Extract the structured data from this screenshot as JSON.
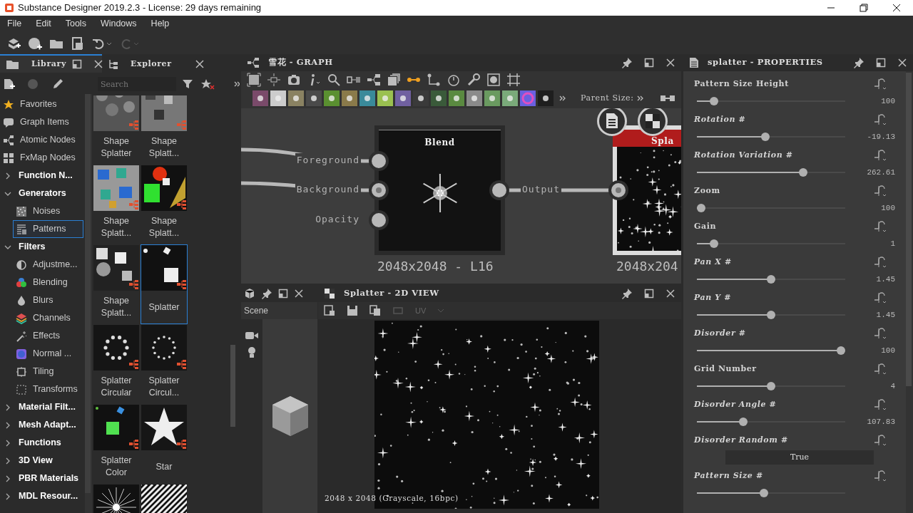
{
  "window": {
    "title": "Substance Designer 2019.2.3 - License: 29 days remaining"
  },
  "menu": [
    "File",
    "Edit",
    "Tools",
    "Windows",
    "Help"
  ],
  "library": {
    "tabs": [
      {
        "label": "Library",
        "selected": true
      },
      {
        "label": "Explorer",
        "selected": false
      }
    ],
    "search": {
      "placeholder": "Search"
    },
    "tree": [
      {
        "label": "Favorites",
        "kind": "item",
        "selected": false
      },
      {
        "label": "Graph Items",
        "kind": "item",
        "selected": false
      },
      {
        "label": "Atomic Nodes",
        "kind": "item",
        "selected": false
      },
      {
        "label": "FxMap Nodes",
        "kind": "item",
        "selected": false
      },
      {
        "label": "Function N...",
        "kind": "group",
        "expanded": false,
        "selected": false
      },
      {
        "label": "Generators",
        "kind": "group",
        "expanded": true,
        "selected": false,
        "children": [
          {
            "label": "Noises",
            "selected": false
          },
          {
            "label": "Patterns",
            "selected": true
          }
        ]
      },
      {
        "label": "Filters",
        "kind": "group",
        "expanded": true,
        "selected": false,
        "children": [
          {
            "label": "Adjustme...",
            "selected": false
          },
          {
            "label": "Blending",
            "selected": false
          },
          {
            "label": "Blurs",
            "selected": false
          },
          {
            "label": "Channels",
            "selected": false
          },
          {
            "label": "Effects",
            "selected": false
          },
          {
            "label": "Normal ...",
            "selected": false
          },
          {
            "label": "Tiling",
            "selected": false
          },
          {
            "label": "Transforms",
            "selected": false
          }
        ]
      },
      {
        "label": "Material Filt...",
        "kind": "group",
        "expanded": false,
        "selected": false
      },
      {
        "label": "Mesh Adapt...",
        "kind": "group",
        "expanded": false,
        "selected": false
      },
      {
        "label": "Functions",
        "kind": "group",
        "expanded": false,
        "selected": false
      },
      {
        "label": "3D View",
        "kind": "group",
        "expanded": false,
        "selected": false
      },
      {
        "label": "PBR Materials",
        "kind": "group",
        "expanded": false,
        "selected": false
      },
      {
        "label": "MDL Resour...",
        "kind": "group",
        "expanded": false,
        "selected": false
      }
    ],
    "thumbnails": [
      {
        "label": "Shape Splatter",
        "selected": false
      },
      {
        "label": "Shape Splatt...",
        "selected": false
      },
      {
        "label": "Shape Splatt...",
        "selected": false
      },
      {
        "label": "Shape Splatt...",
        "selected": false
      },
      {
        "label": "Shape Splatt...",
        "selected": false
      },
      {
        "label": "Splatter",
        "selected": true
      },
      {
        "label": "Splatter Circular",
        "selected": false
      },
      {
        "label": "Splatter Circul...",
        "selected": false
      },
      {
        "label": "Splatter Color",
        "selected": false
      },
      {
        "label": "Star",
        "selected": false
      },
      {
        "selected": false
      },
      {
        "selected": false
      }
    ]
  },
  "graph": {
    "title": "雪花 - GRAPH",
    "parent_size_label": "Parent Size:",
    "nodes": [
      {
        "title": "Blend",
        "inputs": [
          "Foreground",
          "Background",
          "Opacity"
        ],
        "output": "Output",
        "resolution": "2048x2048 - L16"
      },
      {
        "title": "Spla",
        "resolution": "2048x204"
      }
    ]
  },
  "view3d": {
    "scene_label": "Scene"
  },
  "view2d": {
    "title": "Splatter - 2D VIEW",
    "uv_label": "UV",
    "status": "2048 x 2048 (Grayscale, 16bpc)"
  },
  "properties": {
    "title": "splatter - PROPERTIES",
    "params": [
      {
        "kind": "slider",
        "label": "Pattern Size Height",
        "italic": false,
        "level": 0.09,
        "value": "100"
      },
      {
        "kind": "slider",
        "label": "Rotation #",
        "italic": true,
        "level": 0.46,
        "value": "-19.13"
      },
      {
        "kind": "slider",
        "label": "Rotation Variation #",
        "italic": true,
        "level": 0.73,
        "value": "262.61"
      },
      {
        "kind": "slider",
        "label": "Zoom",
        "italic": false,
        "level": 0,
        "value": "100"
      },
      {
        "kind": "slider",
        "label": "Gain",
        "italic": false,
        "level": 0.09,
        "value": "1"
      },
      {
        "kind": "slider",
        "label": "Pan X #",
        "italic": true,
        "level": 0.5,
        "value": "1.45"
      },
      {
        "kind": "slider",
        "label": "Pan Y #",
        "italic": true,
        "level": 0.5,
        "value": "1.45"
      },
      {
        "kind": "slider",
        "label": "Disorder #",
        "italic": true,
        "level": 1,
        "value": "100"
      },
      {
        "kind": "slider",
        "label": "Grid Number",
        "italic": false,
        "level": 0.5,
        "value": "4"
      },
      {
        "kind": "slider",
        "label": "Disorder Angle #",
        "italic": true,
        "level": 0.3,
        "value": "107.83"
      },
      {
        "kind": "dropdown",
        "label": "Disorder Random #",
        "italic": true,
        "value": "True"
      },
      {
        "kind": "slider",
        "label": "Pattern Size #",
        "italic": true,
        "level": 0.45
      }
    ]
  }
}
